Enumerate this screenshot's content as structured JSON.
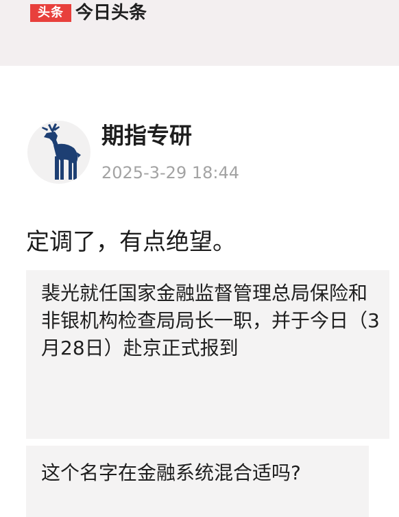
{
  "app": {
    "logo_text": "头条",
    "name": "今日头条"
  },
  "post": {
    "author": "期指专研",
    "timestamp": "2025-3-29 18:44",
    "avatar_icon": "deer-icon",
    "text": "定调了，有点绝望。",
    "quote": "裴光就任国家金融监督管理总局保险和非银机构检查局局长一职，并于今日（3月28日）赴京正式报到",
    "comment": "这个名字在金融系统混合适吗?"
  },
  "colors": {
    "brand": "#e8403c",
    "avatar_figure": "#1d3f73",
    "timestamp": "#a3a3a3"
  }
}
